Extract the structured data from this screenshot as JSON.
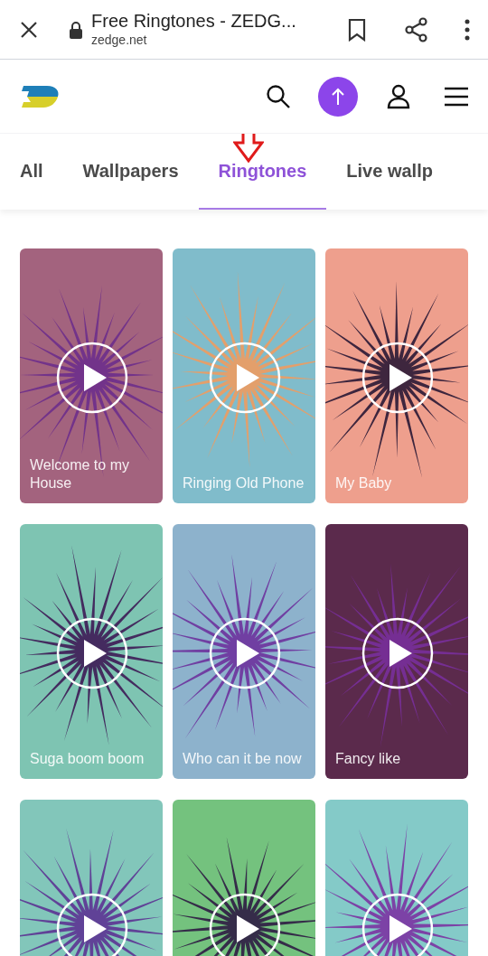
{
  "browser": {
    "title": "Free Ringtones - ZEDG...",
    "url": "zedge.net"
  },
  "tabs": [
    {
      "label": "All",
      "selected": false
    },
    {
      "label": "Wallpapers",
      "selected": false
    },
    {
      "label": "Ringtones",
      "selected": true
    },
    {
      "label": "Live wallp",
      "selected": false
    }
  ],
  "cards": [
    {
      "title": "Welcome to my House",
      "color": "#a3637e"
    },
    {
      "title": "Ringing Old Phone",
      "color": "#80bccb"
    },
    {
      "title": "My Baby",
      "color": "#ee9f8d"
    },
    {
      "title": "Suga boom boom",
      "color": "#7ec4b2"
    },
    {
      "title": "Who can it be now",
      "color": "#8db2cc"
    },
    {
      "title": "Fancy like",
      "color": "#5b2a4c"
    },
    {
      "color": "#82c6ba"
    },
    {
      "color": "#74c27e"
    },
    {
      "color": "#84cac8"
    }
  ]
}
